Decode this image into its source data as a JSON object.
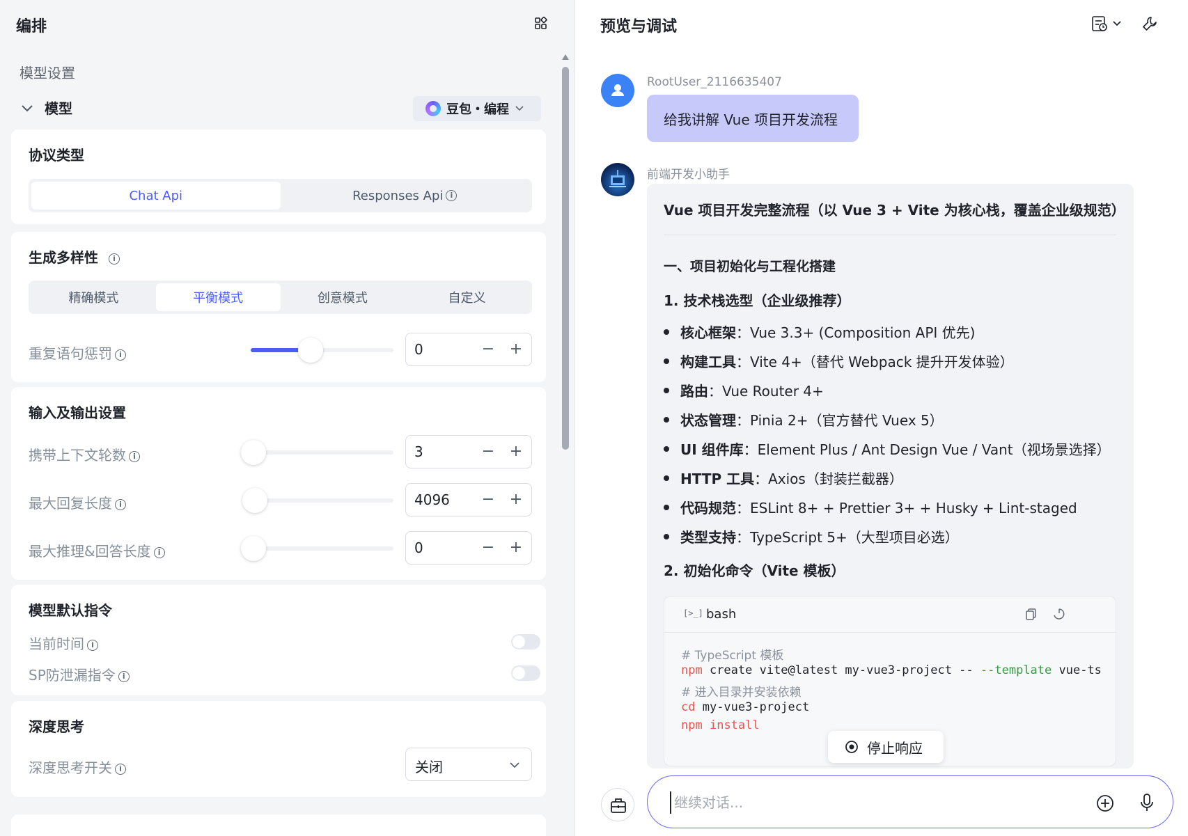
{
  "left": {
    "header": "编排",
    "section_title": "模型设置",
    "model_label": "模型",
    "model_select": "豆包・编程",
    "protocol": {
      "title": "协议类型",
      "options": [
        "Chat Api",
        "Responses Api"
      ],
      "active": "Chat Api"
    },
    "diversity": {
      "title": "生成多样性",
      "modes": [
        "精确模式",
        "平衡模式",
        "创意模式",
        "自定义"
      ],
      "active": "平衡模式",
      "repeat_penalty": {
        "label": "重复语句惩罚",
        "value": "0",
        "slider_level": 0.42
      }
    },
    "io": {
      "title": "输入及输出设置",
      "context_rounds": {
        "label": "携带上下文轮数",
        "value": "3",
        "slider_level": 0.0
      },
      "max_reply": {
        "label": "最大回复长度",
        "value": "4096",
        "slider_level": 0.03
      },
      "max_reasoning": {
        "label": "最大推理&回答长度",
        "value": "0",
        "slider_level": 0.0
      },
      "minus": "−",
      "plus": "+"
    },
    "instructions": {
      "title": "模型默认指令",
      "current_time": {
        "label": "当前时间",
        "enabled": false
      },
      "sp_leak": {
        "label": "SP防泄漏指令",
        "enabled": false
      }
    },
    "deep_think": {
      "title": "深度思考",
      "switch_label": "深度思考开关",
      "value": "关闭"
    }
  },
  "right": {
    "header": "预览与调试",
    "user": {
      "name": "RootUser_2116635407",
      "message": "给我讲解 Vue 项目开发流程"
    },
    "bot": {
      "name": "前端开发小助手",
      "title": "Vue 项目开发完整流程（以 Vue 3 + Vite 为核心栈，覆盖企业级规范）",
      "section1": "一、项目初始化与工程化搭建",
      "sub1": "1. 技术栈选型（企业级推荐）",
      "items": [
        {
          "key": "核心框架",
          "value": "：Vue 3.3+ (Composition API 优先)"
        },
        {
          "key": "构建工具",
          "value": "：Vite 4+（替代 Webpack 提升开发体验）"
        },
        {
          "key": "路由",
          "value": "：Vue Router 4+"
        },
        {
          "key": "状态管理",
          "value": "：Pinia 2+（官方替代 Vuex 5）"
        },
        {
          "key": "UI 组件库",
          "value": "：Element Plus / Ant Design Vue / Vant（视场景选择）"
        },
        {
          "key": "HTTP 工具",
          "value": "：Axios（封装拦截器）"
        },
        {
          "key": "代码规范",
          "value": "：ESLint 8+ + Prettier 3+ + Husky + Lint-staged"
        },
        {
          "key": "类型支持",
          "value": "：TypeScript 5+（大型项目必选）"
        }
      ],
      "sub2": "2. 初始化命令（Vite 模板）",
      "code": {
        "terminal_glyph": "[>_]",
        "lang": "bash",
        "line1": "# TypeScript 模板",
        "line2_cmd": "npm",
        "line2_mid": " create vite@latest my-vue3-project -- ",
        "line2_flag": "--template",
        "line2_end": " vue-ts",
        "line3": "# 进入目录并安装依赖",
        "line4_cmd": "cd",
        "line4_rest": " my-vue3-project",
        "line5_cmd": "npm",
        "line5_rest": "install"
      }
    },
    "stop_button": "停止响应",
    "input_placeholder": "继续对话..."
  },
  "colors": {
    "accent": "#4a5ef5",
    "user_bubble": "#c7c9fb",
    "input_border": "#6a68ea",
    "code_red": "#e8554e",
    "code_green": "#2e9e3a"
  }
}
